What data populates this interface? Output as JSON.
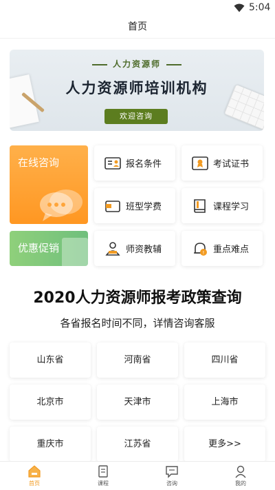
{
  "status_bar": {
    "time": "5:04",
    "wifi_icon": "wifi-icon"
  },
  "header": {
    "title": "首页"
  },
  "banner": {
    "subtitle": "人力资源师",
    "title": "人力资源师培训机构",
    "button_label": "欢迎咨询"
  },
  "quick_tiles": {
    "consult": {
      "label": "在线咨询",
      "icon": "chat-bubbles-icon"
    },
    "promo": {
      "label": "优惠促销",
      "icon": "document-icon"
    }
  },
  "menu": [
    {
      "label": "报名条件",
      "icon": "id-card-icon"
    },
    {
      "label": "考试证书",
      "icon": "certificate-icon"
    },
    {
      "label": "班型学费",
      "icon": "wallet-icon"
    },
    {
      "label": "课程学习",
      "icon": "book-icon"
    },
    {
      "label": "师资教辅",
      "icon": "teacher-icon"
    },
    {
      "label": "重点难点",
      "icon": "alert-bell-icon"
    }
  ],
  "policy": {
    "title": "2020人力资源师报考政策查询",
    "subtitle": "各省报名时间不同，详情咨询客服"
  },
  "provinces": [
    "山东省",
    "河南省",
    "四川省",
    "北京市",
    "天津市",
    "上海市",
    "重庆市",
    "江苏省",
    "更多>>"
  ],
  "tabbar": {
    "active_color": "#f29b22",
    "tabs": [
      {
        "label": "首页",
        "icon": "home-icon",
        "active": true
      },
      {
        "label": "课程",
        "icon": "course-icon",
        "active": false
      },
      {
        "label": "咨询",
        "icon": "consult-icon",
        "active": false
      },
      {
        "label": "我的",
        "icon": "profile-icon",
        "active": false
      }
    ]
  }
}
